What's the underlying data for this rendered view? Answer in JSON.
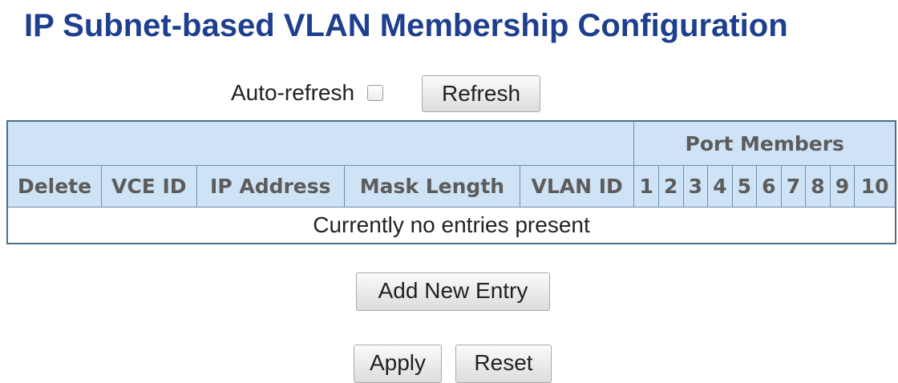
{
  "title": "IP Subnet-based VLAN Membership Configuration",
  "auto_refresh": {
    "label": "Auto-refresh",
    "checked": false
  },
  "buttons": {
    "refresh": "Refresh",
    "add_new_entry": "Add New Entry",
    "apply": "Apply",
    "reset": "Reset"
  },
  "table": {
    "group_header": "Port Members",
    "columns": [
      "Delete",
      "VCE ID",
      "IP Address",
      "Mask Length",
      "VLAN ID"
    ],
    "ports": [
      "1",
      "2",
      "3",
      "4",
      "5",
      "6",
      "7",
      "8",
      "9",
      "10"
    ],
    "empty_message": "Currently no entries present"
  },
  "colors": {
    "title": "#1e3f8f",
    "header_background": "#cfe3f6",
    "header_text": "#5c5c5c",
    "table_border": "#4a6f8a"
  }
}
